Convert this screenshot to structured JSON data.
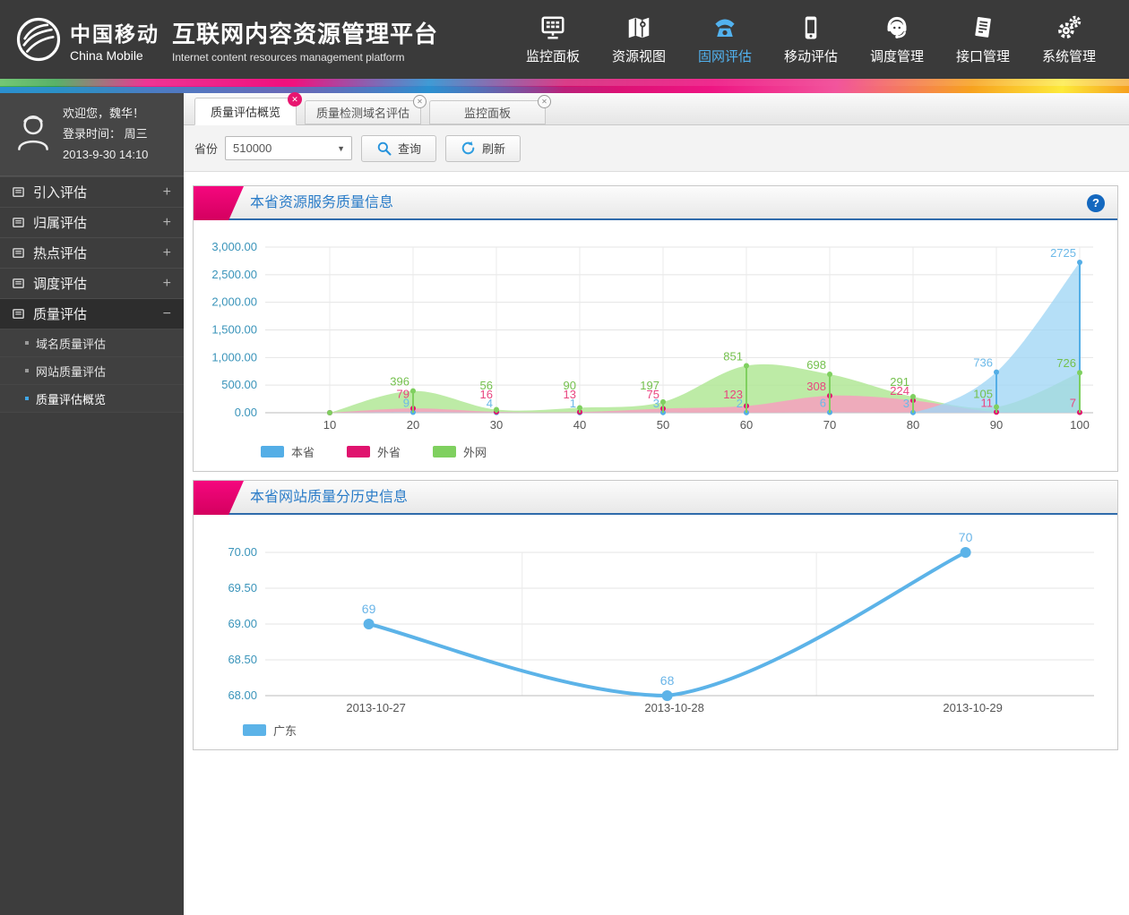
{
  "header": {
    "logo_cn": "中国移动",
    "logo_en": "China Mobile",
    "title": "互联网内容资源管理平台",
    "subtitle": "Internet content resources management platform",
    "nav": [
      {
        "label": "监控面板",
        "icon": "dashboard-icon",
        "active": false
      },
      {
        "label": "资源视图",
        "icon": "map-icon",
        "active": false
      },
      {
        "label": "固网评估",
        "icon": "phone-icon",
        "active": true
      },
      {
        "label": "移动评估",
        "icon": "mobile-icon",
        "active": false
      },
      {
        "label": "调度管理",
        "icon": "headset-icon",
        "active": false
      },
      {
        "label": "接口管理",
        "icon": "document-icon",
        "active": false
      },
      {
        "label": "系统管理",
        "icon": "gears-icon",
        "active": false
      }
    ],
    "active_color": "#52b2ef"
  },
  "sidebar": {
    "user": {
      "greeting": "欢迎您，魏华！",
      "login_line": "登录时间：  周三",
      "login_date": "2013-9-30   14:10"
    },
    "menu": [
      {
        "label": "引入评估",
        "expand": "+"
      },
      {
        "label": "归属评估",
        "expand": "+"
      },
      {
        "label": "热点评估",
        "expand": "+"
      },
      {
        "label": "调度评估",
        "expand": "+"
      },
      {
        "label": "质量评估",
        "expand": "−",
        "expanded": true
      }
    ],
    "submenu": [
      {
        "label": "域名质量评估",
        "active": false
      },
      {
        "label": "网站质量评估",
        "active": false
      },
      {
        "label": "质量评估概览",
        "active": true
      }
    ]
  },
  "tabs": [
    {
      "label": "质量评估概览",
      "active": true
    },
    {
      "label": "质量检测域名评估",
      "active": false
    },
    {
      "label": "监控面板",
      "active": false
    }
  ],
  "filter": {
    "province_label": "省份",
    "province_value": "510000",
    "search_label": "查询",
    "refresh_label": "刷新"
  },
  "icons": {
    "close": "✕",
    "caret": "▼",
    "help": "?"
  },
  "chart_data": [
    {
      "type": "area",
      "title": "本省资源服务质量信息",
      "x": [
        10,
        20,
        30,
        40,
        50,
        60,
        70,
        80,
        90,
        100
      ],
      "ylim": [
        0,
        3000
      ],
      "ytick_labels": [
        "0.00",
        "500.00",
        "1,000.00",
        "1,500.00",
        "2,000.00",
        "2,500.00",
        "3,000.00"
      ],
      "grid": true,
      "legend_position": "bottom",
      "axis_label_color": "#3a94ba",
      "series": [
        {
          "name": "本省",
          "line": "#54aee6",
          "fill": "rgba(160,214,245,0.78)",
          "label_color": "#6cb9e8",
          "values": [
            0,
            9,
            4,
            1,
            3,
            2,
            6,
            3,
            736,
            2725
          ]
        },
        {
          "name": "外省",
          "line": "#e0136e",
          "fill": "rgba(247,160,190,0.85)",
          "label_color": "#e8457f",
          "values": [
            0,
            79,
            16,
            13,
            75,
            123,
            308,
            224,
            11,
            7
          ]
        },
        {
          "name": "外网",
          "line": "#7fd05f",
          "fill": "rgba(178,232,150,0.85)",
          "label_color": "#74c04d",
          "values": [
            0,
            396,
            56,
            90,
            197,
            851,
            698,
            291,
            105,
            726
          ]
        }
      ]
    },
    {
      "type": "line",
      "title": "本省网站质量分历史信息",
      "categories": [
        "2013-10-27",
        "2013-10-28",
        "2013-10-29"
      ],
      "ylim": [
        68,
        70
      ],
      "ytick_labels": [
        "68.00",
        "68.50",
        "69.00",
        "69.50",
        "70.00"
      ],
      "grid": true,
      "legend_position": "bottom",
      "axis_label_color": "#3a94ba",
      "series": [
        {
          "name": "广东",
          "line": "#5cb3e8",
          "label_color": "#6ab5e8",
          "values": [
            69,
            68,
            70
          ]
        }
      ]
    }
  ]
}
